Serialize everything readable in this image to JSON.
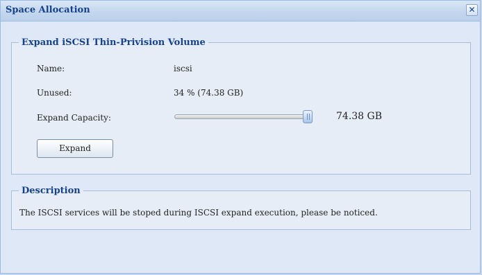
{
  "window": {
    "title": "Space Allocation",
    "close_glyph": "✕"
  },
  "volume_panel": {
    "legend": "Expand iSCSI Thin-Privision Volume",
    "name_label": "Name:",
    "name_value": "iscsi",
    "unused_label": "Unused:",
    "unused_value": "34 % (74.38 GB)",
    "capacity_label": "Expand Capacity:",
    "capacity_value": "74.38 GB",
    "capacity_fraction": 1.0,
    "expand_button": "Expand"
  },
  "description_panel": {
    "legend": "Description",
    "text": "The ISCSI services will be stoped during ISCSI expand execution, please be noticed."
  },
  "colors": {
    "title_text": "#15428b",
    "window_bg": "#dfe8f6",
    "border": "#99bbe8"
  },
  "icons": {
    "close": "close-icon",
    "slider_thumb": "slider-thumb-grip-icon"
  }
}
